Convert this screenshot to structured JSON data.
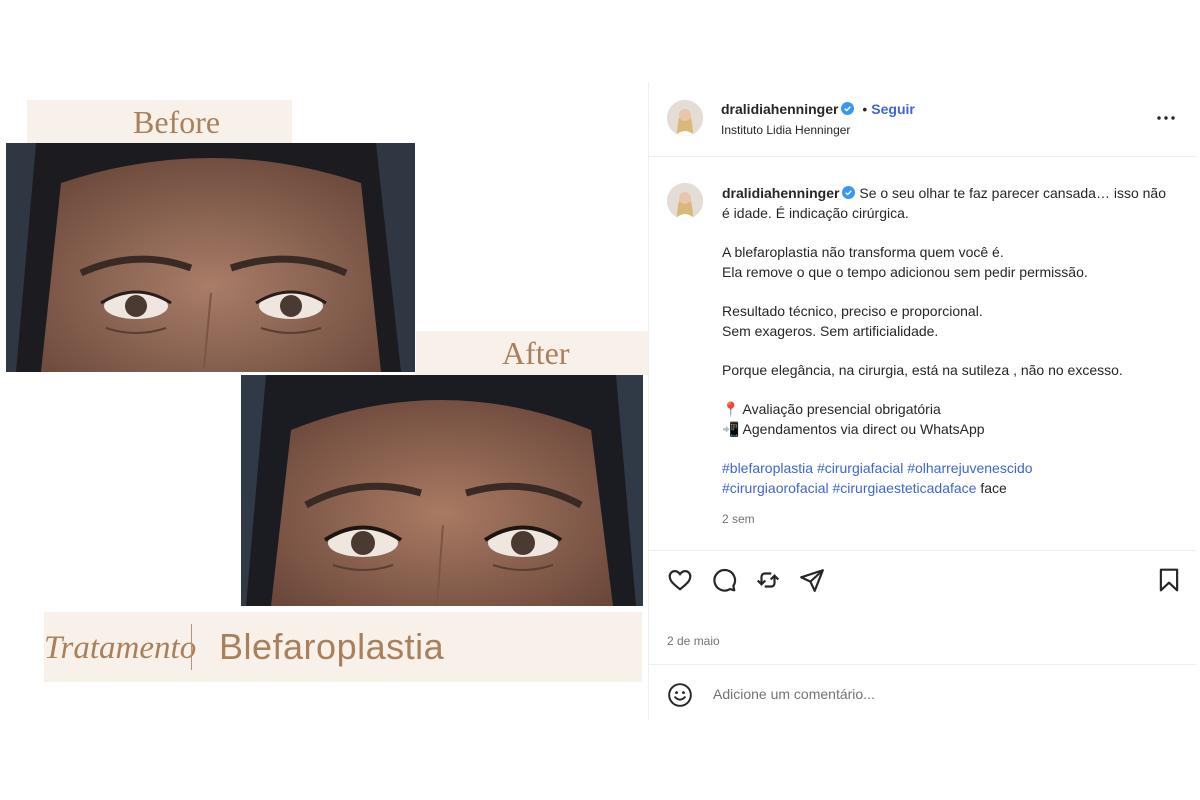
{
  "media": {
    "before_label": "Before",
    "after_label": "After",
    "treatment_word": "Tratamento",
    "treatment_name": "Blefaroplastia"
  },
  "post": {
    "username": "dralidiahenninger",
    "follow_label": "Seguir",
    "separator": "•",
    "subtitle": "Instituto Lidia Henninger",
    "caption_intro": "Se o seu olhar te faz parecer cansada… isso não é idade. É indicação cirúrgica.",
    "caption_p2": [
      "A blefaroplastia não transforma quem você é.",
      "Ela remove o que o tempo adicionou sem pedir permissão."
    ],
    "caption_p3": [
      "Resultado técnico, preciso e proporcional.",
      "Sem exageros. Sem artificialidade."
    ],
    "caption_p4": "Porque elegância, na cirurgia, está na sutileza , não no excesso.",
    "caption_p5": [
      "📍 Avaliação presencial obrigatória",
      "📲 Agendamentos via direct ou WhatsApp"
    ],
    "hashtags_line1": "#blefaroplastia #cirurgiafacial #olharrejuvenescido",
    "hashtags_line2": "#cirurgiaorofacial #cirurgiaesteticadaface",
    "hashtags_tail": " face",
    "caption_time": "2 sem",
    "post_date": "2 de maio",
    "comment_placeholder": "Adicione um comentário...",
    "colors": {
      "link": "#3f64d6",
      "verified": "#3897f0",
      "accent": "#a8805c",
      "label_bg": "#f8f1ea"
    }
  }
}
